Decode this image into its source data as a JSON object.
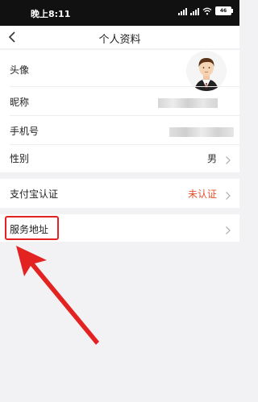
{
  "status_bar": {
    "time": "晚上8:11",
    "battery": "46"
  },
  "nav": {
    "title": "个人资料"
  },
  "profile": {
    "avatar_label": "头像",
    "nickname_label": "昵称",
    "phone_label": "手机号",
    "gender_label": "性别",
    "gender_value": "男"
  },
  "alipay": {
    "label": "支付宝认证",
    "status": "未认证"
  },
  "service_address": {
    "label": "服务地址"
  },
  "colors": {
    "status_warning": "#e0522e",
    "highlight": "#e32222"
  }
}
